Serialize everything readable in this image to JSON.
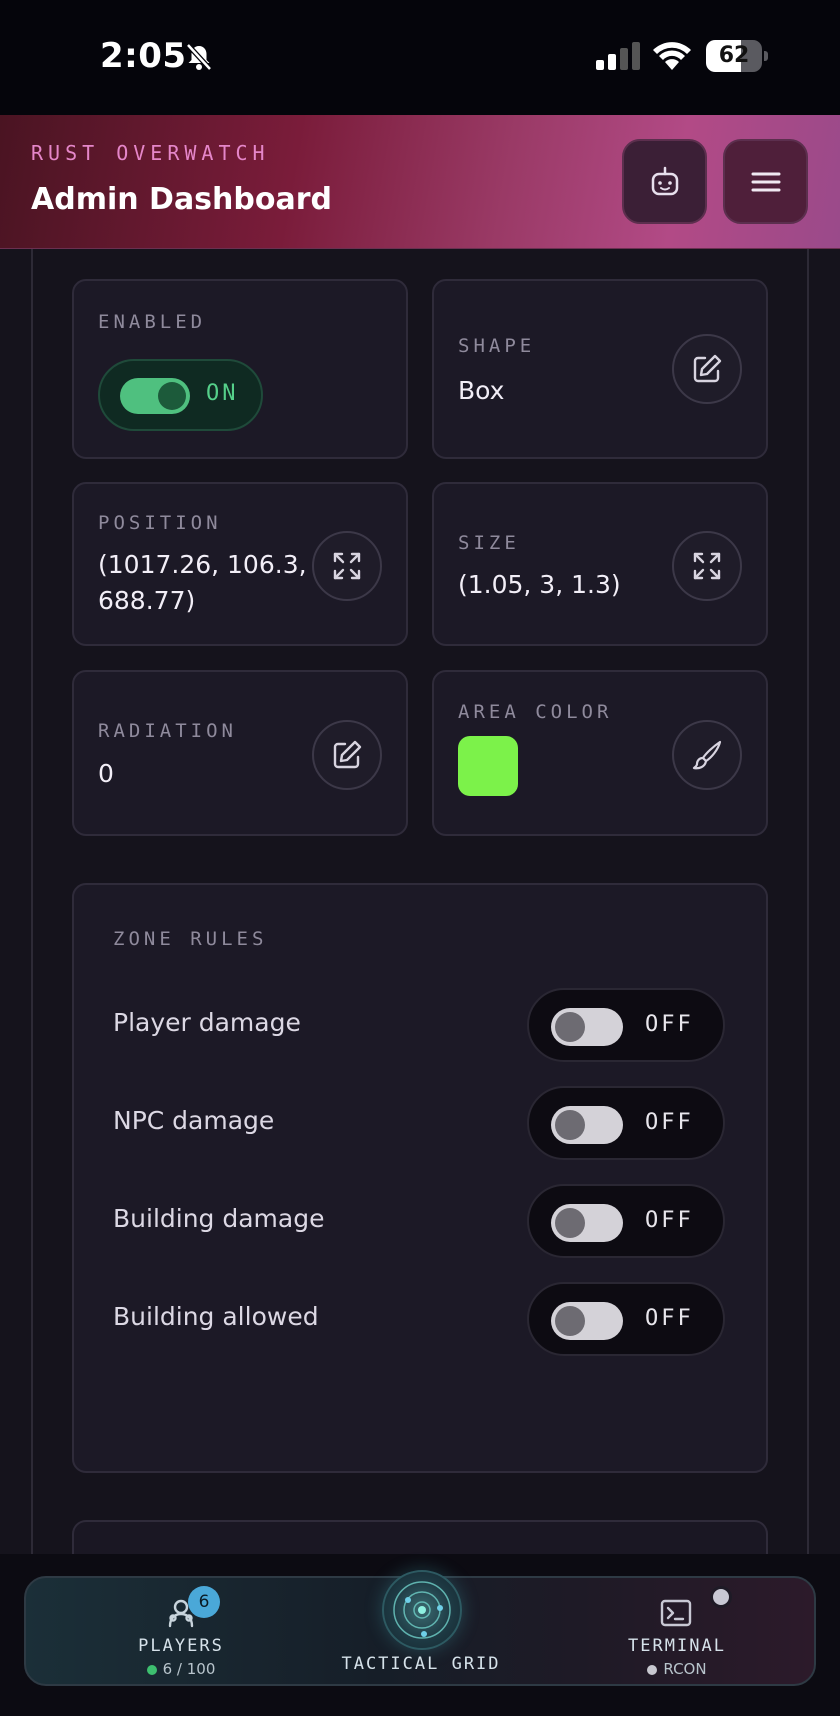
{
  "status_bar": {
    "time": "2:05",
    "battery": "62",
    "battery_level": 0.62
  },
  "header": {
    "subtitle": "RUST OVERWATCH",
    "title": "Admin Dashboard"
  },
  "cards": {
    "enabled": {
      "label": "ENABLED",
      "state": "ON"
    },
    "shape": {
      "label": "SHAPE",
      "value": "Box"
    },
    "position": {
      "label": "POSITION",
      "value_line1": "(1017.26, 106.3,",
      "value_line2": "688.77)"
    },
    "size": {
      "label": "SIZE",
      "value": "(1.05, 3, 1.3)"
    },
    "radiation": {
      "label": "RADIATION",
      "value": "0"
    },
    "area_color": {
      "label": "AREA COLOR",
      "color": "#7cf24a"
    }
  },
  "zone_rules": {
    "title": "ZONE RULES",
    "rules": [
      {
        "label": "Player damage",
        "state": "OFF"
      },
      {
        "label": "NPC damage",
        "state": "OFF"
      },
      {
        "label": "Building damage",
        "state": "OFF"
      },
      {
        "label": "Building allowed",
        "state": "OFF"
      }
    ]
  },
  "bottom_nav": {
    "players": {
      "label": "PLAYERS",
      "count": "6 / 100",
      "badge": "6"
    },
    "tactical_grid": {
      "label": "TACTICAL GRID"
    },
    "terminal": {
      "label": "TERMINAL",
      "status": "RCON"
    }
  },
  "colors": {
    "accent_pink": "#e586c9",
    "on_green": "#4fc07f",
    "area_color": "#7cf24a"
  }
}
